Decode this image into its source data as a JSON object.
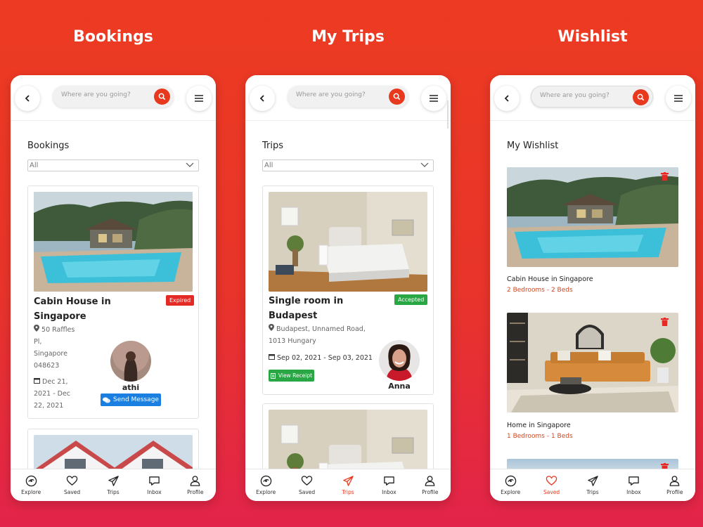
{
  "colors": {
    "accent": "#e8391e",
    "expired": "#e42a25",
    "accepted": "#29a745",
    "message": "#1a7fe0"
  },
  "panels": [
    {
      "heading": "Bookings",
      "search_placeholder": "Where are you going?",
      "section_title": "Bookings",
      "filter_value": "All",
      "card": {
        "title_line1": "Cabin House in",
        "title_line2": "Singapore",
        "status": "Expired",
        "address_line1": "50 Raffles",
        "address_line2": "Pl,",
        "address_line3": "Singapore",
        "address_line4": "048623",
        "dates_line1": "Dec 21,",
        "dates_line2": "2021 - Dec",
        "dates_line3": "22, 2021",
        "host_name": "athi",
        "action_label": "Send Message"
      }
    },
    {
      "heading": "My Trips",
      "search_placeholder": "Where are you going?",
      "section_title": "Trips",
      "filter_value": "All",
      "card": {
        "title_line1": "Single room in",
        "title_line2": "Budapest",
        "status": "Accepted",
        "address_line1": "Budapest, Unnamed Road,",
        "address_line2": "1013 Hungary",
        "dates": "Sep 02, 2021 - Sep 03, 2021",
        "action_label": "View Receipt",
        "host_name": "Anna"
      }
    },
    {
      "heading": "Wishlist",
      "search_placeholder": "Where are you going?",
      "section_title": "My Wishlist",
      "items": [
        {
          "title": "Cabin House in Singapore",
          "details": "2 Bedrooms - 2 Beds"
        },
        {
          "title": "Home in Singapore",
          "details": "1 Bedrooms - 1 Beds"
        }
      ]
    }
  ],
  "nav": [
    {
      "label": "Explore",
      "icon": "explore-icon"
    },
    {
      "label": "Saved",
      "icon": "heart-icon"
    },
    {
      "label": "Trips",
      "icon": "paper-plane-icon"
    },
    {
      "label": "Inbox",
      "icon": "inbox-icon"
    },
    {
      "label": "Profile",
      "icon": "profile-icon"
    }
  ],
  "active_nav": [
    "none",
    "Trips",
    "Saved"
  ]
}
